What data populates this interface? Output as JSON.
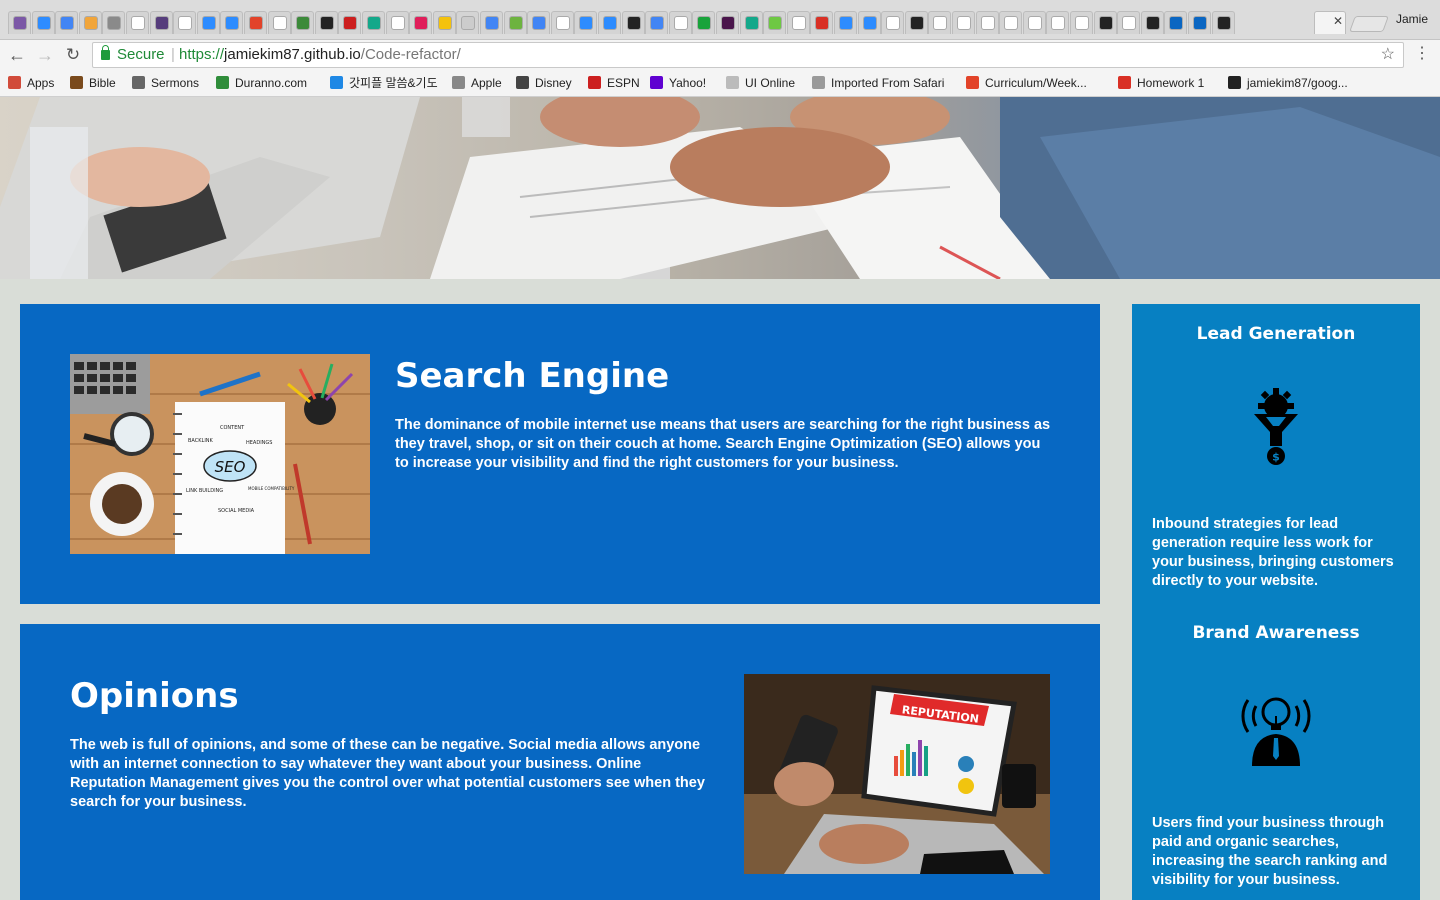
{
  "browser": {
    "profile_name": "Jamie",
    "secure_label": "Secure",
    "url_scheme": "https://",
    "url_host": "jamiekim87.github.io",
    "url_path": "/Code-refactor/",
    "tab_favicon_colors": [
      "#7b58a6",
      "#2d8cff",
      "#4285f4",
      "#f1a53a",
      "#8a8a8a",
      "#ffffff",
      "#563d7c",
      "#ffffff",
      "#2d8cff",
      "#2d8cff",
      "#e2432a",
      "#ffffff",
      "#3c8a3a",
      "#222222",
      "#cc1f1f",
      "#14a88a",
      "#ffffff",
      "#e01e5a",
      "#f4c20d",
      "#cccccc",
      "#4285f4",
      "#6db33f",
      "#4285f4",
      "#ffffff",
      "#2d8cff",
      "#2d8cff",
      "#222222",
      "#4285f4",
      "#ffffff",
      "#19a33b",
      "#4a154b",
      "#14a88a",
      "#6ec843",
      "#ffffff",
      "#d93025",
      "#2d8cff",
      "#2d8cff",
      "#ffffff",
      "#222222",
      "#ffffff",
      "#ffffff",
      "#ffffff",
      "#ffffff",
      "#ffffff",
      "#ffffff",
      "#ffffff",
      "#222222",
      "#ffffff",
      "#222222",
      "#0a66c2",
      "#0a66c2",
      "#222222"
    ],
    "bookmarks": [
      {
        "label": "Apps",
        "color": "#d14b3a"
      },
      {
        "label": "Bible",
        "color": "#7a4a1c"
      },
      {
        "label": "Sermons",
        "color": "#666666"
      },
      {
        "label": "Duranno.com",
        "color": "#2f8d3a"
      },
      {
        "label": "갓피플 말씀&기도",
        "color": "#1e88e5"
      },
      {
        "label": "Apple",
        "color": "#888888"
      },
      {
        "label": "Disney",
        "color": "#444444"
      },
      {
        "label": "ESPN",
        "color": "#cc1f1f"
      },
      {
        "label": "Yahoo!",
        "color": "#5f01d1"
      },
      {
        "label": "UI Online",
        "color": "#bbbbbb"
      },
      {
        "label": "Imported From Safari",
        "color": "#9a9a9a"
      },
      {
        "label": "Curriculum/Week...",
        "color": "#e24329"
      },
      {
        "label": "Homework 1",
        "color": "#d93025"
      },
      {
        "label": "jamiekim87/goog...",
        "color": "#222222"
      }
    ]
  },
  "cards": [
    {
      "title": "Search Engine",
      "text": "The dominance of mobile internet use means that users are searching for the right business as they travel, shop, or sit on their couch at home. Search Engine Optimization (SEO) allows you to increase your visibility and find the right customers for your business.",
      "image_labels": [
        "CONTENT",
        "BACKLINK",
        "HEADINGS",
        "SEO",
        "LINK BUILDING",
        "MOBILE COMPATIBILITY",
        "SOCIAL MEDIA"
      ]
    },
    {
      "title": "Opinions",
      "text": "The web is full of opinions, and some of these can be negative. Social media allows anyone with an internet connection to say whatever they want about your business. Online Reputation Management gives you the control over what potential customers see when they search for your business.",
      "image_label": "REPUTATION"
    }
  ],
  "sidebar": [
    {
      "title": "Lead Generation",
      "icon": "funnel-gear-dollar-icon",
      "text": "Inbound strategies for lead generation require less work for your business, bringing customers directly to your website."
    },
    {
      "title": "Brand Awareness",
      "icon": "lightbulb-broadcast-icon",
      "text": "Users find your business through paid and organic searches, increasing the search ranking and visibility for your business."
    }
  ],
  "colors": {
    "page_bg": "#d9ddd7",
    "card_bg": "#0768c3",
    "sidebar_bg": "#0780c2"
  }
}
